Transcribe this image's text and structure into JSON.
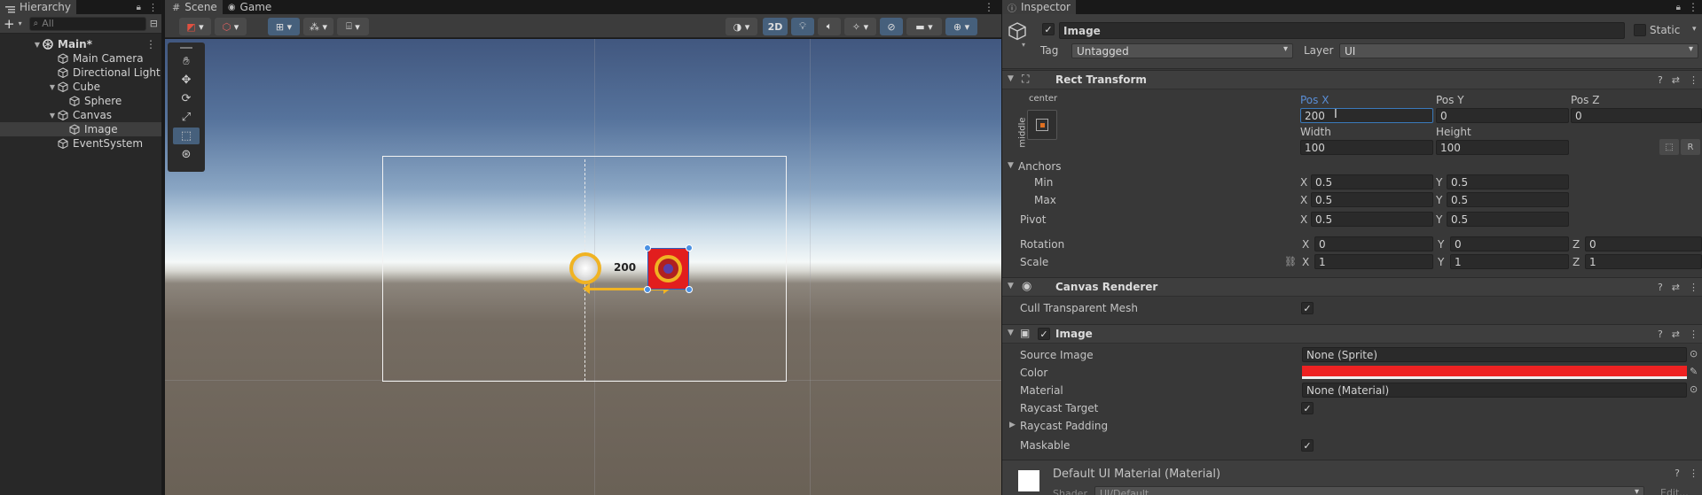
{
  "hierarchy": {
    "tab": "Hierarchy",
    "search_placeholder": "All",
    "rows": [
      "Main*",
      "Main Camera",
      "Directional Light",
      "Cube",
      "Sphere",
      "Canvas",
      "Image",
      "EventSystem"
    ]
  },
  "scene": {
    "tabs": [
      "Scene",
      "Game"
    ],
    "mode_2d": "2D",
    "measure_label": "200"
  },
  "inspector": {
    "tab": "Inspector",
    "object_name": "Image",
    "static_label": "Static",
    "tag_label": "Tag",
    "tag_value": "Untagged",
    "layer_label": "Layer",
    "layer_value": "UI",
    "rect": {
      "title": "Rect Transform",
      "anchor_h": "center",
      "anchor_v": "middle",
      "posx_label": "Pos X",
      "posx": "200",
      "posy_label": "Pos Y",
      "posy": "0",
      "posz_label": "Pos Z",
      "posz": "0",
      "width_label": "Width",
      "width": "100",
      "height_label": "Height",
      "height": "100",
      "r_label": "R",
      "anchors_label": "Anchors",
      "min_label": "Min",
      "min_x": "0.5",
      "min_y": "0.5",
      "max_label": "Max",
      "max_x": "0.5",
      "max_y": "0.5",
      "pivot_label": "Pivot",
      "pivot_x": "0.5",
      "pivot_y": "0.5",
      "rotation_label": "Rotation",
      "rot_x": "0",
      "rot_y": "0",
      "rot_z": "0",
      "scale_label": "Scale",
      "scale_x": "1",
      "scale_y": "1",
      "scale_z": "1",
      "x": "X",
      "y": "Y",
      "z": "Z"
    },
    "canvas_renderer": {
      "title": "Canvas Renderer",
      "cull_label": "Cull Transparent Mesh"
    },
    "image": {
      "title": "Image",
      "source_label": "Source Image",
      "source_value": "None (Sprite)",
      "color_label": "Color",
      "color": "#ee2222",
      "material_label": "Material",
      "material_value": "None (Material)",
      "raycast_target_label": "Raycast Target",
      "raycast_padding_label": "Raycast Padding",
      "maskable_label": "Maskable"
    },
    "material": {
      "title": "Default UI Material (Material)",
      "shader_label": "Shader",
      "shader_value": "UI/Default",
      "edit_label": "Edit..."
    }
  }
}
